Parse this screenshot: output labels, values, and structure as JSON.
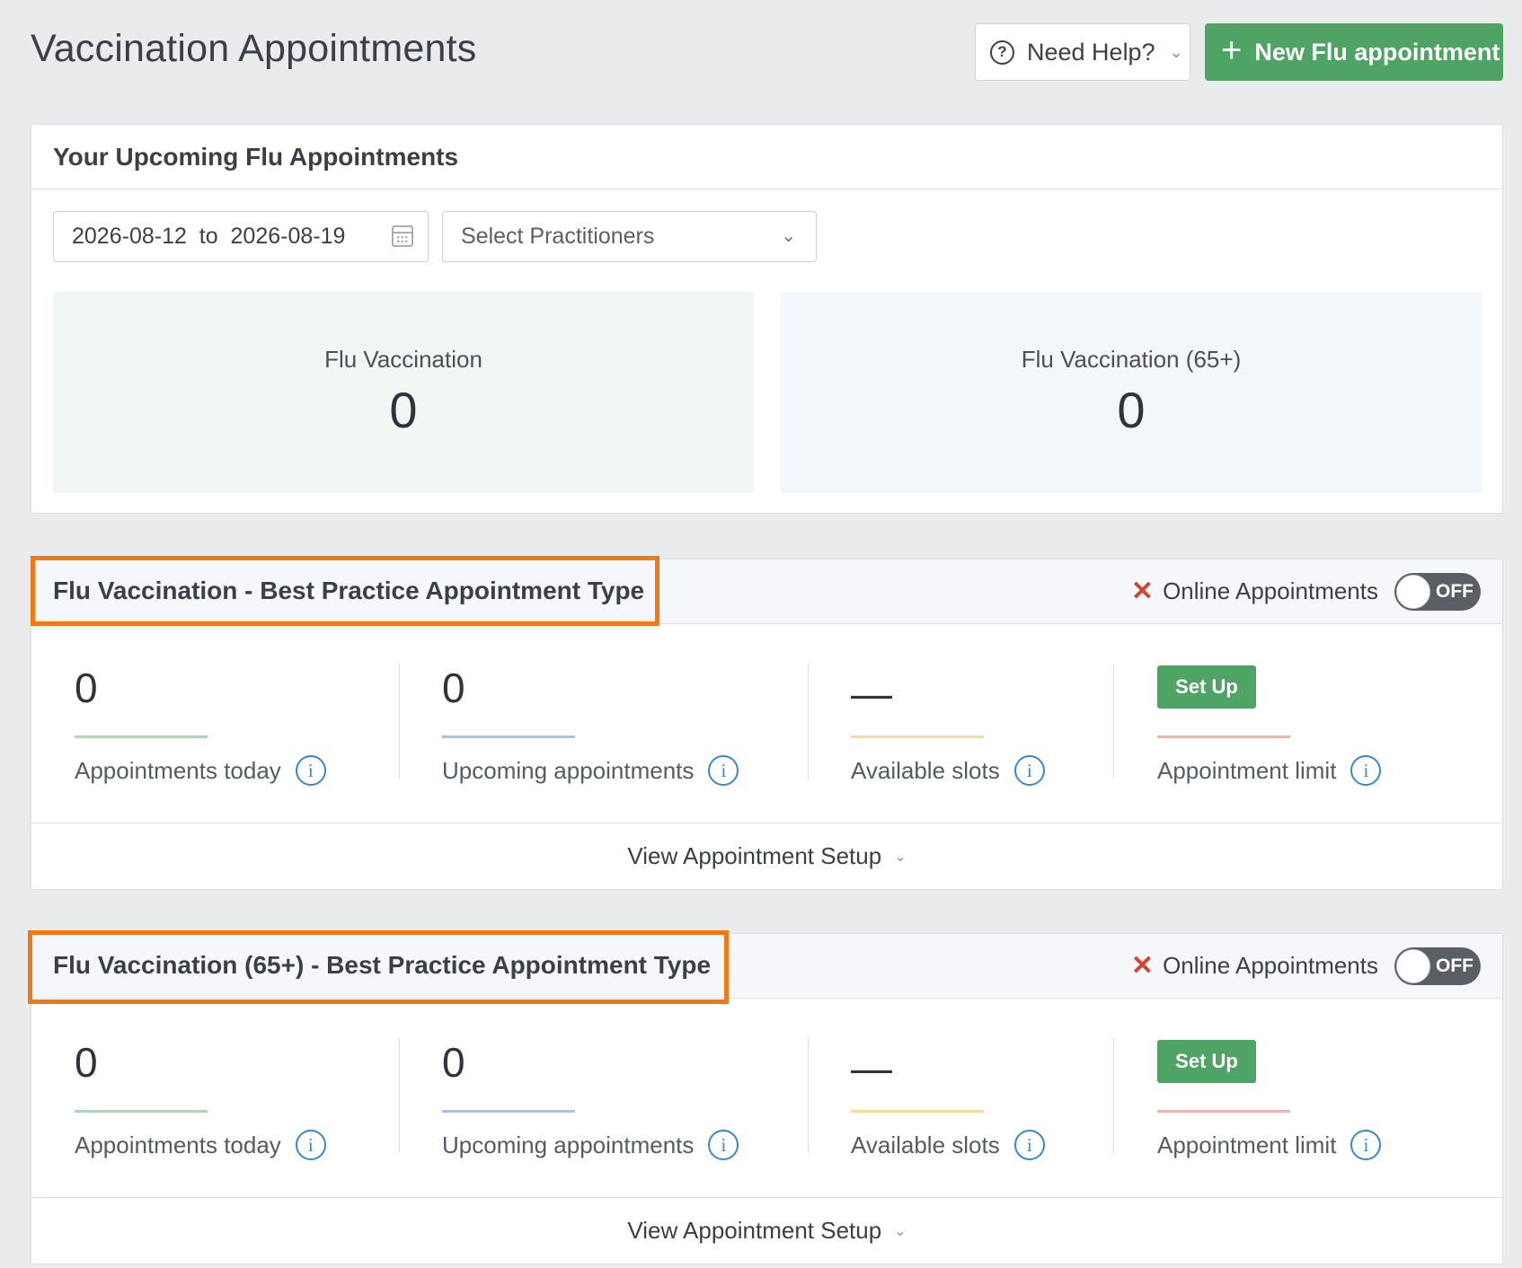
{
  "header": {
    "title": "Vaccination Appointments",
    "help_label": "Need Help?",
    "new_label": "New Flu appointment"
  },
  "upcoming": {
    "title": "Your Upcoming Flu Appointments",
    "date_range": "2026-08-12  to  2026-08-19",
    "practitioners_placeholder": "Select Practitioners",
    "stats": [
      {
        "label": "Flu Vaccination",
        "value": "0"
      },
      {
        "label": "Flu Vaccination (65+)",
        "value": "0"
      }
    ]
  },
  "types": [
    {
      "title": "Flu Vaccination - Best Practice Appointment Type",
      "online_label": "Online Appointments",
      "toggle_label": "OFF",
      "appointments_today": "0",
      "appointments_today_label": "Appointments today",
      "upcoming": "0",
      "upcoming_label": "Upcoming appointments",
      "available_slots": "—",
      "available_slots_label": "Available slots",
      "setup_label": "Set Up",
      "limit_label": "Appointment limit",
      "view_setup": "View Appointment Setup"
    },
    {
      "title": "Flu Vaccination (65+) - Best Practice Appointment Type",
      "online_label": "Online Appointments",
      "toggle_label": "OFF",
      "appointments_today": "0",
      "appointments_today_label": "Appointments today",
      "upcoming": "0",
      "upcoming_label": "Upcoming appointments",
      "available_slots": "—",
      "available_slots_label": "Available slots",
      "setup_label": "Set Up",
      "limit_label": "Appointment limit",
      "view_setup": "View Appointment Setup"
    }
  ],
  "colors": {
    "accent_green": "#4fa364",
    "highlight_orange": "#f27813",
    "off_red": "#d04534",
    "info_blue": "#3d86c6",
    "line_green": "#a9d8b6",
    "line_blue": "#a9c1e8",
    "line_yellow": "#f3dd9a",
    "line_red": "#f0b4ae"
  }
}
